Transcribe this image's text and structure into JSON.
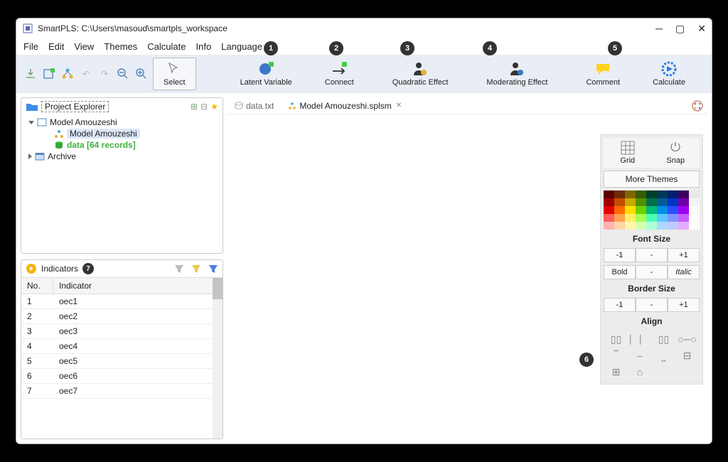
{
  "title": "SmartPLS: C:\\Users\\masoud\\smartpls_workspace",
  "menu": [
    "File",
    "Edit",
    "View",
    "Themes",
    "Calculate",
    "Info",
    "Language"
  ],
  "toolbar": {
    "select": "Select",
    "latent_variable": "Latent Variable",
    "connect": "Connect",
    "quadratic_effect": "Quadratic Effect",
    "moderating_effect": "Moderating Effect",
    "comment": "Comment",
    "calculate": "Calculate"
  },
  "explorer": {
    "title": "Project Explorer",
    "nodes": {
      "model": "Model Amouzeshi",
      "sub_model": "Model Amouzeshi",
      "data": "data [64 records]",
      "archive": "Archive"
    }
  },
  "indicators": {
    "title": "Indicators",
    "columns": {
      "no": "No.",
      "indicator": "Indicator"
    },
    "rows": [
      {
        "no": "1",
        "ind": "oec1"
      },
      {
        "no": "2",
        "ind": "oec2"
      },
      {
        "no": "3",
        "ind": "oec3"
      },
      {
        "no": "4",
        "ind": "oec4"
      },
      {
        "no": "5",
        "ind": "oec5"
      },
      {
        "no": "6",
        "ind": "oec6"
      },
      {
        "no": "7",
        "ind": "oec7"
      }
    ]
  },
  "tabs": {
    "data": "data.txt",
    "model": "Model Amouzeshi.splsm"
  },
  "right": {
    "grid": "Grid",
    "snap": "Snap",
    "more_themes": "More Themes",
    "font_size": "Font Size",
    "border_size": "Border Size",
    "bold": "Bold",
    "italic": "Italic",
    "minus1": "-1",
    "plus1": "+1",
    "dash": "-",
    "align": "Align"
  },
  "badges": {
    "b1": "1",
    "b2": "2",
    "b3": "3",
    "b4": "4",
    "b5": "5",
    "b6": "6",
    "b7": "7"
  },
  "colors": [
    "#5a0000",
    "#6e2a04",
    "#7d6600",
    "#355c00",
    "#003f2b",
    "#003858",
    "#001f6d",
    "#3e005f",
    "#e8e8e8",
    "#a00000",
    "#c24d00",
    "#c7a900",
    "#4f9100",
    "#00704c",
    "#005c97",
    "#0035c0",
    "#6f00a8",
    "#f4f4f4",
    "#e60000",
    "#ff6a00",
    "#ffe000",
    "#6ecf00",
    "#00b97b",
    "#008eea",
    "#2a4eff",
    "#9f00f0",
    "#fbfbfb",
    "#ff5c5c",
    "#ffa24f",
    "#ffee66",
    "#a6ff4f",
    "#4fffb0",
    "#5cc6ff",
    "#7f95ff",
    "#c65cff",
    "#ffffff",
    "#ffb3b3",
    "#ffd5a8",
    "#fff6ad",
    "#d4ffad",
    "#adffd8",
    "#add8ff",
    "#c0caff",
    "#e2adff",
    "#ffffff"
  ]
}
